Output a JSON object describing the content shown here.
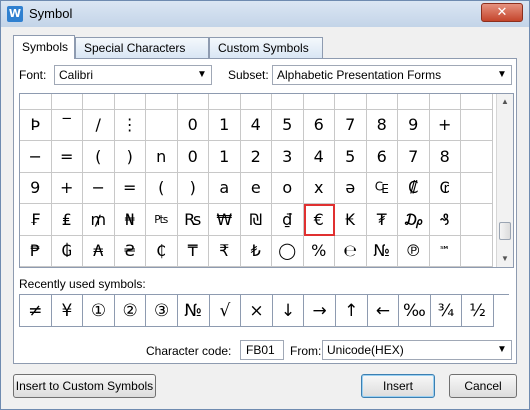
{
  "window": {
    "title": "Symbol",
    "close_glyph": "✕",
    "app_glyph": "W"
  },
  "tabs": [
    {
      "label": "Symbols",
      "active": true
    },
    {
      "label": "Special Characters",
      "active": false
    },
    {
      "label": "Custom Symbols",
      "active": false
    }
  ],
  "font": {
    "label": "Font:",
    "value": "Calibri"
  },
  "subset": {
    "label": "Subset:",
    "value": "Alphabetic Presentation Forms"
  },
  "grid": {
    "rows": [
      [
        "”",
        "",
        "",
        "",
        "",
        "",
        "",
        "",
        "",
        "",
        "",
        "",
        "",
        "",
        ""
      ],
      [
        "Þ",
        "‾",
        "/",
        "⋮",
        "",
        "0",
        "1",
        "4",
        "5",
        "6",
        "7",
        "8",
        "9",
        "+",
        ""
      ],
      [
        "−",
        "=",
        "(",
        ")",
        "n",
        "0",
        "1",
        "2",
        "3",
        "4",
        "5",
        "6",
        "7",
        "8",
        ""
      ],
      [
        "9",
        "+",
        "−",
        "=",
        "(",
        ")",
        "a",
        "e",
        "o",
        "x",
        "ə",
        "₠",
        "₡",
        "₢",
        ""
      ],
      [
        "₣",
        "₤",
        "₥",
        "₦",
        "₧",
        "₨",
        "₩",
        "₪",
        "₫",
        "€",
        "₭",
        "₮",
        "₯",
        "₰",
        ""
      ],
      [
        "₱",
        "₲",
        "₳",
        "₴",
        "₵",
        "₸",
        "₹",
        "₺",
        "◯",
        "%",
        "℮",
        "№",
        "℗",
        "℠",
        ""
      ]
    ],
    "selected": "€"
  },
  "recent": {
    "label": "Recently used symbols:",
    "symbols": [
      "≠",
      "¥",
      "①",
      "②",
      "③",
      "№",
      "√",
      "×",
      "↓",
      "→",
      "↑",
      "←",
      "‰",
      "¾",
      "½"
    ]
  },
  "character_code": {
    "label": "Character code:",
    "value": "FB01"
  },
  "from": {
    "label": "From:",
    "value": "Unicode(HEX)"
  },
  "buttons": {
    "insert_custom": "Insert to Custom Symbols",
    "insert": "Insert",
    "cancel": "Cancel"
  },
  "icons": {
    "dropdown_arrow": "▼",
    "scroll_up": "▲",
    "scroll_down": "▼"
  }
}
